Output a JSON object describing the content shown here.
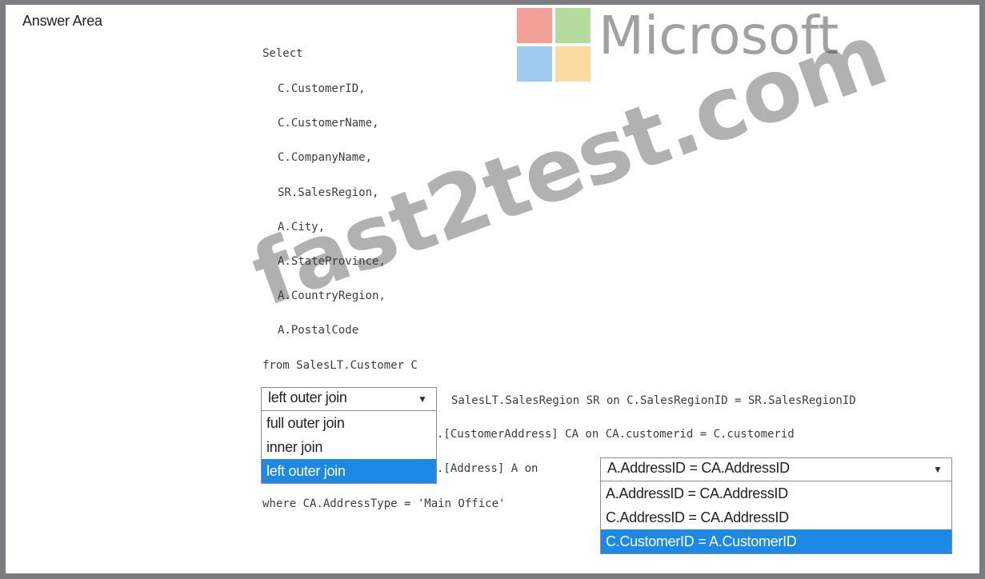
{
  "header": {
    "title": "Answer Area"
  },
  "logo": {
    "text": "Microsoft"
  },
  "watermark": {
    "text": "fast2test.com"
  },
  "code": {
    "select": "Select",
    "columns": [
      "C.CustomerID,",
      "C.CustomerName,",
      "C.CompanyName,",
      "SR.SalesRegion,",
      "A.City,",
      "A.StateProvince,",
      "A.CountryRegion,",
      "A.PostalCode"
    ],
    "from": "from SalesLT.Customer C",
    "join1_rest": "SalesLT.SalesRegion SR on C.SalesRegionID = SR.SalesRegionID",
    "join2_rest": ".[CustomerAddress] CA on CA.customerid = C.customerid",
    "join3_rest": ".[Address] A on",
    "where": "where CA.AddressType = 'Main Office'"
  },
  "join_select": {
    "value": "left outer join",
    "options": [
      "full outer join",
      "inner join",
      "left outer join"
    ],
    "selected_index": 2
  },
  "on_select": {
    "value": "A.AddressID = CA.AddressID",
    "options": [
      "A.AddressID = CA.AddressID",
      "C.AddressID = CA.AddressID",
      "C.CustomerID = A.CustomerID"
    ],
    "selected_index": 2
  },
  "colors": {
    "highlight": "#1e88e5",
    "border": "#7b7d80"
  }
}
